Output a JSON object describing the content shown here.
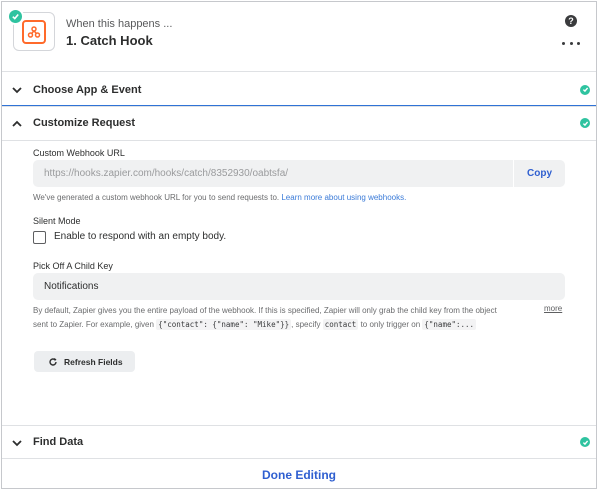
{
  "header": {
    "subtitle": "When this happens ...",
    "title": "1. Catch Hook",
    "help_label": "?"
  },
  "sections": {
    "choose_app": {
      "label": "Choose App & Event",
      "status": "complete"
    },
    "customize": {
      "label": "Customize Request",
      "status": "complete",
      "expanded": true
    },
    "find_data": {
      "label": "Find Data",
      "status": "complete"
    }
  },
  "webhook": {
    "label": "Custom Webhook URL",
    "url": "https://hooks.zapier.com/hooks/catch/8352930/oabtsfa/",
    "copy_label": "Copy",
    "help_text": "We've generated a custom webhook URL for you to send requests to.",
    "help_link": "Learn more about using webhooks."
  },
  "silent_mode": {
    "label": "Silent Mode",
    "checkbox_label": "Enable to respond with an empty body.",
    "checked": false
  },
  "child_key": {
    "label": "Pick Off A Child Key",
    "value": "Notifications",
    "help_line1": "By default, Zapier gives you the entire payload of the webhook. If this is specified, Zapier will only grab the child key from the object",
    "help_line2_a": "sent to Zapier. For example, given",
    "code1": "{\"contact\": {\"name\": \"Mike\"}}",
    "help_line2_b": ", specify",
    "code2": "contact",
    "help_line2_c": "to only trigger on",
    "code3": "{\"name\":...",
    "more_label": "more"
  },
  "refresh_label": "Refresh Fields",
  "done_label": "Done Editing",
  "colors": {
    "accent": "#2f5fd0",
    "success": "#2fc3a0",
    "brand": "#ff6a2b"
  }
}
